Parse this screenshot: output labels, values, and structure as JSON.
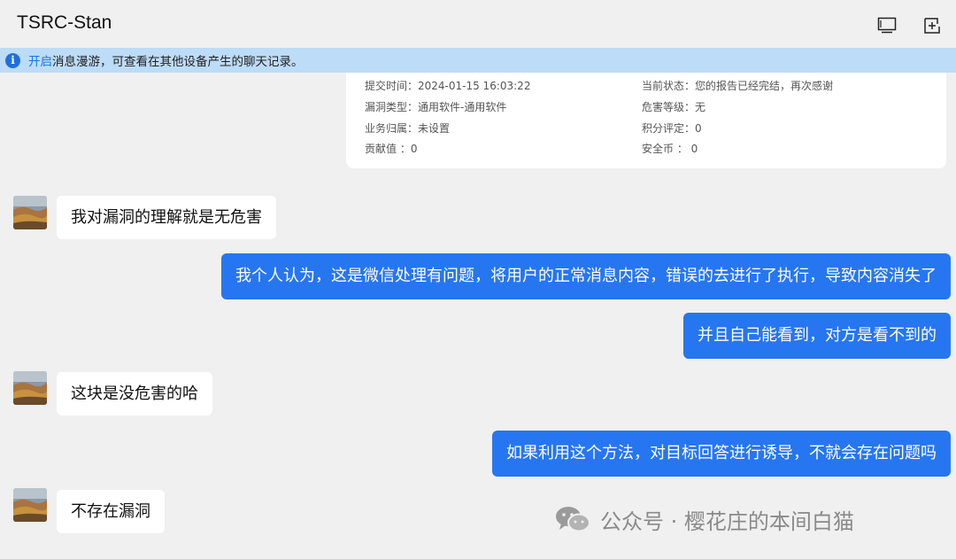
{
  "header": {
    "title": "TSRC-Stan",
    "screen_icon": "monitor-icon",
    "add_icon": "add-window-icon"
  },
  "banner": {
    "icon": "info-icon",
    "link_text": "开启",
    "text": "消息漫游，可查看在其他设备产生的聊天记录。"
  },
  "report_card": {
    "left": [
      "提交时间：2024-01-15 16:03:22",
      "漏洞类型：通用软件-通用软件",
      "业务归属：未设置",
      "贡献值 ：0"
    ],
    "right": [
      "当前状态：您的报告已经完结，再次感谢",
      "危害等级：无",
      "积分评定：0",
      "安全币 ： 0"
    ]
  },
  "messages": [
    {
      "side": "left",
      "text": "我对漏洞的理解就是无危害"
    },
    {
      "side": "right",
      "text": "我个人认为，这是微信处理有问题，将用户的正常消息内容，错误的去进行了执行，导致内容消失了"
    },
    {
      "side": "right",
      "text": "并且自己能看到，对方是看不到的"
    },
    {
      "side": "left",
      "text": "这块是没危害的哈"
    },
    {
      "side": "right",
      "text": "如果利用这个方法，对目标回答进行诱导，不就会存在问题吗"
    },
    {
      "side": "left",
      "text": "不存在漏洞"
    }
  ],
  "watermark": {
    "icon": "wechat-icon",
    "text": "公众号 · 樱花庄的本间白猫"
  },
  "colors": {
    "background": "#f0f0f0",
    "banner": "#bcdcf7",
    "link": "#1a73e8",
    "sent_bubble": "#2676f2",
    "received_bubble": "#ffffff"
  }
}
